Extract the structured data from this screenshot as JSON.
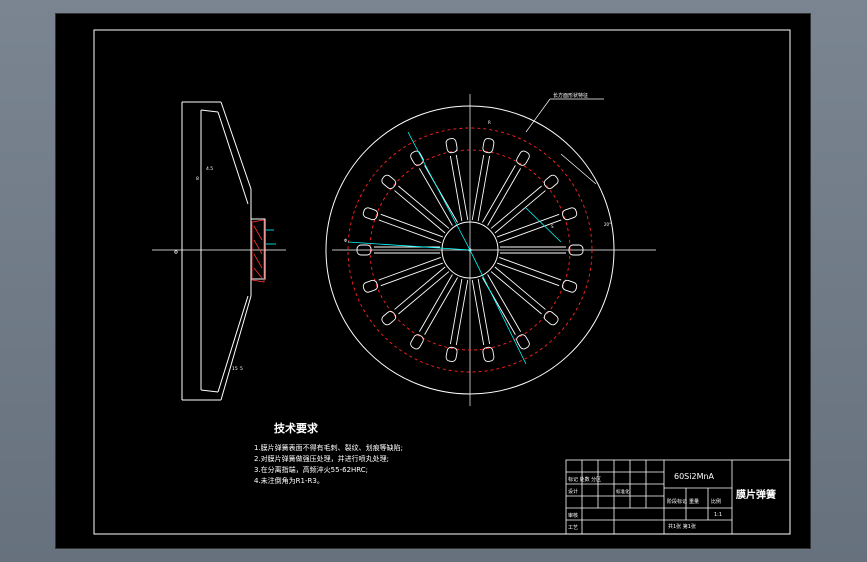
{
  "drawing": {
    "leader_note": "长方面形状特征",
    "dim_labels": {
      "b1": "Φ",
      "b2": "∅1",
      "top": "R",
      "left": "Φ",
      "right_small": "S",
      "angle_right": "20°"
    },
    "section_marks": {
      "m1": "4.5",
      "m2": "8",
      "m3": "15",
      "m4": "5"
    },
    "requirements": {
      "heading": "技术要求",
      "items": [
        "1.膜片弹簧表面不得有毛刺、裂纹、划痕等缺陷;",
        "2.对膜片弹簧做强压处理，并进行喷丸处理;",
        "3.在分离指端，高频淬火55-62HRC;",
        "4.未注倒角为R1-R3。"
      ]
    }
  },
  "title_block": {
    "material": "60Si2MnA",
    "part_name": "膜片弹簧",
    "scale_label": "比例",
    "weight_label": "重量",
    "stage_label": "阶段标记",
    "scale_value": "1:1",
    "sheet_info": "共1张  第1张",
    "rows": [
      "标记 处数 分区",
      "设计",
      "审核",
      "工艺"
    ],
    "standard": "标准化"
  }
}
